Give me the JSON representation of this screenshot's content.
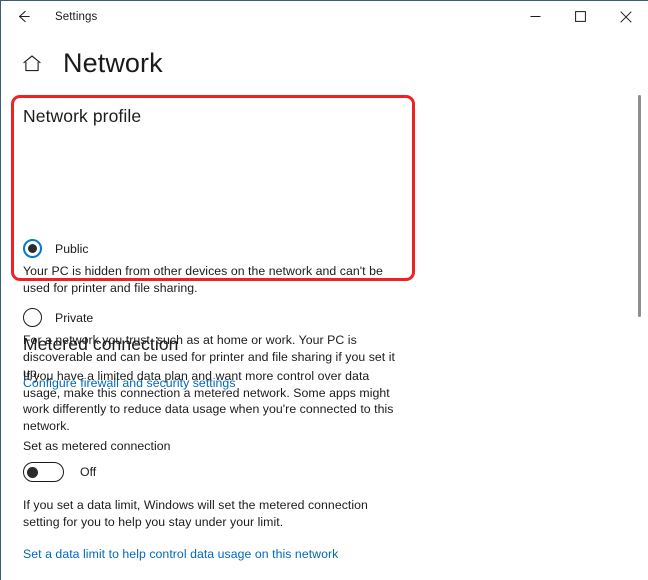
{
  "window": {
    "titlebar": {
      "back_icon": "back-arrow-icon",
      "app_title": "Settings",
      "minimize_label": "Minimize",
      "maximize_label": "Maximize",
      "close_label": "Close"
    },
    "border_color": "#3c5c74"
  },
  "header": {
    "home_icon": "home-icon",
    "title": "Network"
  },
  "network_profile": {
    "heading": "Network profile",
    "options": [
      {
        "label": "Public",
        "selected": true,
        "description": "Your PC is hidden from other devices on the network and can't be used for printer and file sharing."
      },
      {
        "label": "Private",
        "selected": false,
        "description": "For a network you trust, such as at home or work. Your PC is discoverable and can be used for printer and file sharing if you set it up."
      }
    ],
    "link": "Configure firewall and security settings"
  },
  "metered_connection": {
    "heading": "Metered connection",
    "description": "If you have a limited data plan and want more control over data usage, make this connection a metered network. Some apps might work differently to reduce data usage when you're connected to this network.",
    "toggle_label": "Set as metered connection",
    "toggle_state": "Off",
    "limit_description": "If you set a data limit, Windows will set the metered connection setting for you to help you stay under your limit.",
    "link": "Set a data limit to help control data usage on this network"
  },
  "highlight": {
    "color": "#ee2222"
  },
  "colors": {
    "link": "#0067c0",
    "radio_accent": "#0078d4",
    "text": "#1b1b1b",
    "scrollbar": "#8e8e8e"
  },
  "scrollbar": {
    "name": "vertical-scrollbar"
  }
}
